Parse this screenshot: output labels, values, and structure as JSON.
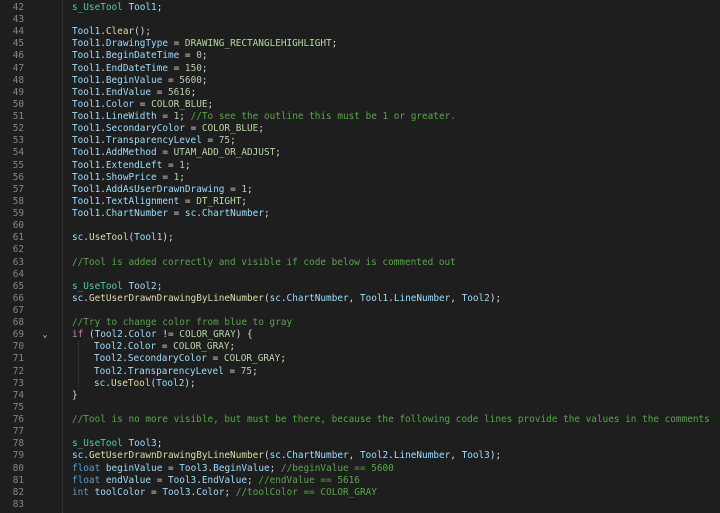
{
  "editor": {
    "lines": [
      {
        "number": "42",
        "tokens": [
          {
            "t": "s_UseTool",
            "c": "ty"
          },
          {
            "t": " ",
            "c": "p"
          },
          {
            "t": "Tool1",
            "c": "id"
          },
          {
            "t": ";",
            "c": "p"
          }
        ]
      },
      {
        "number": "43",
        "tokens": []
      },
      {
        "number": "44",
        "tokens": [
          {
            "t": "Tool1",
            "c": "id"
          },
          {
            "t": ".",
            "c": "p"
          },
          {
            "t": "Clear",
            "c": "fn"
          },
          {
            "t": "();",
            "c": "p"
          }
        ]
      },
      {
        "number": "45",
        "tokens": [
          {
            "t": "Tool1",
            "c": "id"
          },
          {
            "t": ".",
            "c": "p"
          },
          {
            "t": "DrawingType",
            "c": "id"
          },
          {
            "t": " = ",
            "c": "p"
          },
          {
            "t": "DRAWING_RECTANGLEHIGHLIGHT",
            "c": "con"
          },
          {
            "t": ";",
            "c": "p"
          }
        ]
      },
      {
        "number": "46",
        "tokens": [
          {
            "t": "Tool1",
            "c": "id"
          },
          {
            "t": ".",
            "c": "p"
          },
          {
            "t": "BeginDateTime",
            "c": "id"
          },
          {
            "t": " = ",
            "c": "p"
          },
          {
            "t": "0",
            "c": "num"
          },
          {
            "t": ";",
            "c": "p"
          }
        ]
      },
      {
        "number": "47",
        "tokens": [
          {
            "t": "Tool1",
            "c": "id"
          },
          {
            "t": ".",
            "c": "p"
          },
          {
            "t": "EndDateTime",
            "c": "id"
          },
          {
            "t": " = ",
            "c": "p"
          },
          {
            "t": "150",
            "c": "num"
          },
          {
            "t": ";",
            "c": "p"
          }
        ]
      },
      {
        "number": "48",
        "tokens": [
          {
            "t": "Tool1",
            "c": "id"
          },
          {
            "t": ".",
            "c": "p"
          },
          {
            "t": "BeginValue",
            "c": "id"
          },
          {
            "t": " = ",
            "c": "p"
          },
          {
            "t": "5600",
            "c": "num"
          },
          {
            "t": ";",
            "c": "p"
          }
        ]
      },
      {
        "number": "49",
        "tokens": [
          {
            "t": "Tool1",
            "c": "id"
          },
          {
            "t": ".",
            "c": "p"
          },
          {
            "t": "EndValue",
            "c": "id"
          },
          {
            "t": " = ",
            "c": "p"
          },
          {
            "t": "5616",
            "c": "num"
          },
          {
            "t": ";",
            "c": "p"
          }
        ]
      },
      {
        "number": "50",
        "tokens": [
          {
            "t": "Tool1",
            "c": "id"
          },
          {
            "t": ".",
            "c": "p"
          },
          {
            "t": "Color",
            "c": "id"
          },
          {
            "t": " = ",
            "c": "p"
          },
          {
            "t": "COLOR_BLUE",
            "c": "con"
          },
          {
            "t": ";",
            "c": "p"
          }
        ]
      },
      {
        "number": "51",
        "tokens": [
          {
            "t": "Tool1",
            "c": "id"
          },
          {
            "t": ".",
            "c": "p"
          },
          {
            "t": "LineWidth",
            "c": "id"
          },
          {
            "t": " = ",
            "c": "p"
          },
          {
            "t": "1",
            "c": "num"
          },
          {
            "t": "; ",
            "c": "p"
          },
          {
            "t": "//To see the outline this must be 1 or greater.",
            "c": "cm"
          }
        ]
      },
      {
        "number": "52",
        "tokens": [
          {
            "t": "Tool1",
            "c": "id"
          },
          {
            "t": ".",
            "c": "p"
          },
          {
            "t": "SecondaryColor",
            "c": "id"
          },
          {
            "t": " = ",
            "c": "p"
          },
          {
            "t": "COLOR_BLUE",
            "c": "con"
          },
          {
            "t": ";",
            "c": "p"
          }
        ]
      },
      {
        "number": "53",
        "tokens": [
          {
            "t": "Tool1",
            "c": "id"
          },
          {
            "t": ".",
            "c": "p"
          },
          {
            "t": "TransparencyLevel",
            "c": "id"
          },
          {
            "t": " = ",
            "c": "p"
          },
          {
            "t": "75",
            "c": "num"
          },
          {
            "t": ";",
            "c": "p"
          }
        ]
      },
      {
        "number": "54",
        "tokens": [
          {
            "t": "Tool1",
            "c": "id"
          },
          {
            "t": ".",
            "c": "p"
          },
          {
            "t": "AddMethod",
            "c": "id"
          },
          {
            "t": " = ",
            "c": "p"
          },
          {
            "t": "UTAM_ADD_OR_ADJUST",
            "c": "con"
          },
          {
            "t": ";",
            "c": "p"
          }
        ]
      },
      {
        "number": "55",
        "tokens": [
          {
            "t": "Tool1",
            "c": "id"
          },
          {
            "t": ".",
            "c": "p"
          },
          {
            "t": "ExtendLeft",
            "c": "id"
          },
          {
            "t": " = ",
            "c": "p"
          },
          {
            "t": "1",
            "c": "num"
          },
          {
            "t": ";",
            "c": "p"
          }
        ]
      },
      {
        "number": "56",
        "tokens": [
          {
            "t": "Tool1",
            "c": "id"
          },
          {
            "t": ".",
            "c": "p"
          },
          {
            "t": "ShowPrice",
            "c": "id"
          },
          {
            "t": " = ",
            "c": "p"
          },
          {
            "t": "1",
            "c": "num"
          },
          {
            "t": ";",
            "c": "p"
          }
        ]
      },
      {
        "number": "57",
        "tokens": [
          {
            "t": "Tool1",
            "c": "id"
          },
          {
            "t": ".",
            "c": "p"
          },
          {
            "t": "AddAsUserDrawnDrawing",
            "c": "id"
          },
          {
            "t": " = ",
            "c": "p"
          },
          {
            "t": "1",
            "c": "num"
          },
          {
            "t": ";",
            "c": "p"
          }
        ]
      },
      {
        "number": "58",
        "tokens": [
          {
            "t": "Tool1",
            "c": "id"
          },
          {
            "t": ".",
            "c": "p"
          },
          {
            "t": "TextAlignment",
            "c": "id"
          },
          {
            "t": " = ",
            "c": "p"
          },
          {
            "t": "DT_RIGHT",
            "c": "con"
          },
          {
            "t": ";",
            "c": "p"
          }
        ]
      },
      {
        "number": "59",
        "tokens": [
          {
            "t": "Tool1",
            "c": "id"
          },
          {
            "t": ".",
            "c": "p"
          },
          {
            "t": "ChartNumber",
            "c": "id"
          },
          {
            "t": " = ",
            "c": "p"
          },
          {
            "t": "sc",
            "c": "id"
          },
          {
            "t": ".",
            "c": "p"
          },
          {
            "t": "ChartNumber",
            "c": "id"
          },
          {
            "t": ";",
            "c": "p"
          }
        ]
      },
      {
        "number": "60",
        "tokens": []
      },
      {
        "number": "61",
        "tokens": [
          {
            "t": "sc",
            "c": "id"
          },
          {
            "t": ".",
            "c": "p"
          },
          {
            "t": "UseTool",
            "c": "fn"
          },
          {
            "t": "(",
            "c": "p"
          },
          {
            "t": "Tool1",
            "c": "id"
          },
          {
            "t": ");",
            "c": "p"
          }
        ]
      },
      {
        "number": "62",
        "tokens": []
      },
      {
        "number": "63",
        "tokens": [
          {
            "t": "//Tool is added correctly and visible if code below is commented out",
            "c": "cm"
          }
        ]
      },
      {
        "number": "64",
        "tokens": []
      },
      {
        "number": "65",
        "tokens": [
          {
            "t": "s_UseTool",
            "c": "ty"
          },
          {
            "t": " ",
            "c": "p"
          },
          {
            "t": "Tool2",
            "c": "id"
          },
          {
            "t": ";",
            "c": "p"
          }
        ]
      },
      {
        "number": "66",
        "tokens": [
          {
            "t": "sc",
            "c": "id"
          },
          {
            "t": ".",
            "c": "p"
          },
          {
            "t": "GetUserDrawnDrawingByLineNumber",
            "c": "fn"
          },
          {
            "t": "(",
            "c": "p"
          },
          {
            "t": "sc",
            "c": "id"
          },
          {
            "t": ".",
            "c": "p"
          },
          {
            "t": "ChartNumber",
            "c": "id"
          },
          {
            "t": ", ",
            "c": "p"
          },
          {
            "t": "Tool1",
            "c": "id"
          },
          {
            "t": ".",
            "c": "p"
          },
          {
            "t": "LineNumber",
            "c": "id"
          },
          {
            "t": ", ",
            "c": "p"
          },
          {
            "t": "Tool2",
            "c": "id"
          },
          {
            "t": ");",
            "c": "p"
          }
        ]
      },
      {
        "number": "67",
        "tokens": []
      },
      {
        "number": "68",
        "tokens": [
          {
            "t": "//Try to change color from blue to gray",
            "c": "cm"
          }
        ]
      },
      {
        "number": "69",
        "fold": "⌄",
        "tokens": [
          {
            "t": "if",
            "c": "ctl"
          },
          {
            "t": " (",
            "c": "p"
          },
          {
            "t": "Tool2",
            "c": "id"
          },
          {
            "t": ".",
            "c": "p"
          },
          {
            "t": "Color",
            "c": "id"
          },
          {
            "t": " != ",
            "c": "p"
          },
          {
            "t": "COLOR_GRAY",
            "c": "con"
          },
          {
            "t": ") {",
            "c": "p"
          }
        ]
      },
      {
        "number": "70",
        "indent": 1,
        "tokens": [
          {
            "t": "Tool2",
            "c": "id"
          },
          {
            "t": ".",
            "c": "p"
          },
          {
            "t": "Color",
            "c": "id"
          },
          {
            "t": " = ",
            "c": "p"
          },
          {
            "t": "COLOR_GRAY",
            "c": "con"
          },
          {
            "t": ";",
            "c": "p"
          }
        ]
      },
      {
        "number": "71",
        "indent": 1,
        "tokens": [
          {
            "t": "Tool2",
            "c": "id"
          },
          {
            "t": ".",
            "c": "p"
          },
          {
            "t": "SecondaryColor",
            "c": "id"
          },
          {
            "t": " = ",
            "c": "p"
          },
          {
            "t": "COLOR_GRAY",
            "c": "con"
          },
          {
            "t": ";",
            "c": "p"
          }
        ]
      },
      {
        "number": "72",
        "indent": 1,
        "tokens": [
          {
            "t": "Tool2",
            "c": "id"
          },
          {
            "t": ".",
            "c": "p"
          },
          {
            "t": "TransparencyLevel",
            "c": "id"
          },
          {
            "t": " = ",
            "c": "p"
          },
          {
            "t": "75",
            "c": "num"
          },
          {
            "t": ";",
            "c": "p"
          }
        ]
      },
      {
        "number": "73",
        "indent": 1,
        "tokens": [
          {
            "t": "sc",
            "c": "id"
          },
          {
            "t": ".",
            "c": "p"
          },
          {
            "t": "UseTool",
            "c": "fn"
          },
          {
            "t": "(",
            "c": "p"
          },
          {
            "t": "Tool2",
            "c": "id"
          },
          {
            "t": ");",
            "c": "p"
          }
        ]
      },
      {
        "number": "74",
        "tokens": [
          {
            "t": "}",
            "c": "p"
          }
        ]
      },
      {
        "number": "75",
        "tokens": []
      },
      {
        "number": "76",
        "tokens": [
          {
            "t": "//Tool is no more visible, but must be there, because the following code lines provide the values in the comments",
            "c": "cm"
          }
        ]
      },
      {
        "number": "77",
        "tokens": []
      },
      {
        "number": "78",
        "tokens": [
          {
            "t": "s_UseTool",
            "c": "ty"
          },
          {
            "t": " ",
            "c": "p"
          },
          {
            "t": "Tool3",
            "c": "id"
          },
          {
            "t": ";",
            "c": "p"
          }
        ]
      },
      {
        "number": "79",
        "tokens": [
          {
            "t": "sc",
            "c": "id"
          },
          {
            "t": ".",
            "c": "p"
          },
          {
            "t": "GetUserDrawnDrawingByLineNumber",
            "c": "fn"
          },
          {
            "t": "(",
            "c": "p"
          },
          {
            "t": "sc",
            "c": "id"
          },
          {
            "t": ".",
            "c": "p"
          },
          {
            "t": "ChartNumber",
            "c": "id"
          },
          {
            "t": ", ",
            "c": "p"
          },
          {
            "t": "Tool2",
            "c": "id"
          },
          {
            "t": ".",
            "c": "p"
          },
          {
            "t": "LineNumber",
            "c": "id"
          },
          {
            "t": ", ",
            "c": "p"
          },
          {
            "t": "Tool3",
            "c": "id"
          },
          {
            "t": ");",
            "c": "p"
          }
        ]
      },
      {
        "number": "80",
        "tokens": [
          {
            "t": "float",
            "c": "kw"
          },
          {
            "t": " ",
            "c": "p"
          },
          {
            "t": "beginValue",
            "c": "id"
          },
          {
            "t": " = ",
            "c": "p"
          },
          {
            "t": "Tool3",
            "c": "id"
          },
          {
            "t": ".",
            "c": "p"
          },
          {
            "t": "BeginValue",
            "c": "id"
          },
          {
            "t": "; ",
            "c": "p"
          },
          {
            "t": "//beginValue == 5600",
            "c": "cm"
          }
        ]
      },
      {
        "number": "81",
        "tokens": [
          {
            "t": "float",
            "c": "kw"
          },
          {
            "t": " ",
            "c": "p"
          },
          {
            "t": "endValue",
            "c": "id"
          },
          {
            "t": " = ",
            "c": "p"
          },
          {
            "t": "Tool3",
            "c": "id"
          },
          {
            "t": ".",
            "c": "p"
          },
          {
            "t": "EndValue",
            "c": "id"
          },
          {
            "t": "; ",
            "c": "p"
          },
          {
            "t": "//endValue == 5616",
            "c": "cm"
          }
        ]
      },
      {
        "number": "82",
        "tokens": [
          {
            "t": "int",
            "c": "kw"
          },
          {
            "t": " ",
            "c": "p"
          },
          {
            "t": "toolColor",
            "c": "id"
          },
          {
            "t": " = ",
            "c": "p"
          },
          {
            "t": "Tool3",
            "c": "id"
          },
          {
            "t": ".",
            "c": "p"
          },
          {
            "t": "Color",
            "c": "id"
          },
          {
            "t": "; ",
            "c": "p"
          },
          {
            "t": "//toolColor == COLOR_GRAY",
            "c": "cm"
          }
        ]
      },
      {
        "number": "83",
        "tokens": []
      }
    ]
  }
}
